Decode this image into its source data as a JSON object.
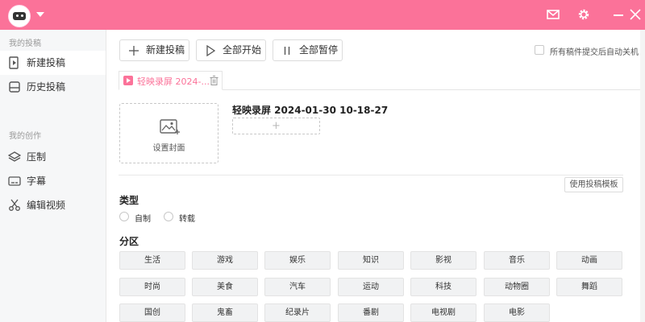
{
  "header": {
    "brand_color": "#fb7299",
    "icons": [
      "avatar",
      "chevron-down-icon",
      "mail-icon",
      "gear-icon",
      "minimize-icon",
      "close-icon"
    ]
  },
  "sidebar": {
    "section1_title": "我的投稿",
    "section1_items": [
      {
        "label": "新建投稿",
        "icon": "upload-video-icon",
        "active": true
      },
      {
        "label": "历史投稿",
        "icon": "inbox-icon",
        "active": false
      }
    ],
    "section2_title": "我的创作",
    "section2_items": [
      {
        "label": "压制",
        "icon": "layers-icon"
      },
      {
        "label": "字幕",
        "icon": "subtitle-icon"
      },
      {
        "label": "编辑视频",
        "icon": "scissors-icon"
      }
    ]
  },
  "toolbar": {
    "new_label": "新建投稿",
    "start_all_label": "全部开始",
    "pause_all_label": "全部暂停",
    "auto_shutdown_label": "所有稿件提交后自动关机"
  },
  "tab": {
    "label": "轻映录屏 2024-..."
  },
  "editor": {
    "cover_label": "设置封面",
    "video_title": "轻映录屏 2024-01-30 10-18-27",
    "add_symbol": "+",
    "template_button": "使用投稿模板",
    "type_title": "类型",
    "type_options": [
      "自制",
      "转载"
    ],
    "zone_title": "分区",
    "zones": [
      [
        "生活",
        "游戏",
        "娱乐",
        "知识",
        "影视",
        "音乐",
        "动画"
      ],
      [
        "时尚",
        "美食",
        "汽车",
        "运动",
        "科技",
        "动物圈",
        "舞蹈"
      ],
      [
        "国创",
        "鬼畜",
        "纪录片",
        "番剧",
        "电视剧",
        "电影"
      ]
    ]
  }
}
